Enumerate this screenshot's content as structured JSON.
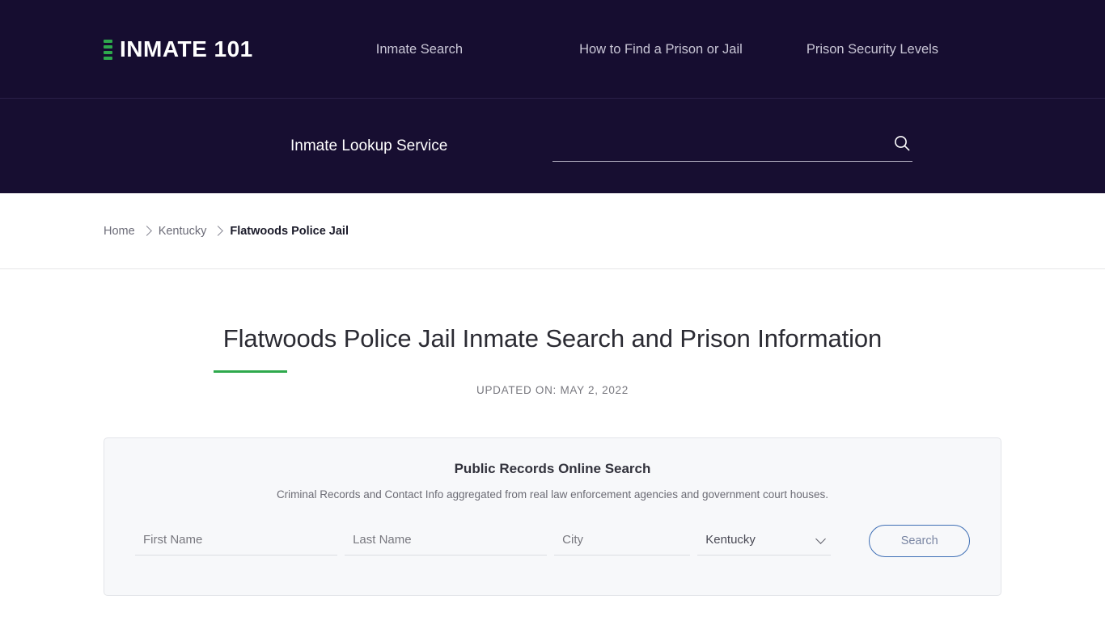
{
  "header": {
    "brand": "INMATE 101",
    "logo_icon": "stacked-bars-icon",
    "nav": [
      {
        "label": "Inmate Search"
      },
      {
        "label": "How to Find a Prison or Jail"
      },
      {
        "label": "Prison Security Levels"
      }
    ],
    "accent_color": "#2ea94c",
    "background_color": "#160D30"
  },
  "lookup": {
    "label": "Inmate Lookup Service",
    "input_value": "",
    "input_placeholder": "",
    "search_icon": "magnifier-icon"
  },
  "breadcrumb": {
    "items": [
      {
        "label": "Home"
      },
      {
        "label": "Kentucky"
      },
      {
        "label": "Flatwoods Police Jail"
      }
    ]
  },
  "main": {
    "title": "Flatwoods Police Jail Inmate Search and Prison Information",
    "updated": "UPDATED ON: MAY 2, 2022"
  },
  "records_card": {
    "title": "Public Records Online Search",
    "subtitle": "Criminal Records and Contact Info aggregated from real law enforcement agencies and government court houses.",
    "fields": {
      "first_name": {
        "value": "",
        "placeholder": "First Name"
      },
      "last_name": {
        "value": "",
        "placeholder": "Last Name"
      },
      "city": {
        "value": "",
        "placeholder": "City"
      },
      "state": {
        "selected": "Kentucky",
        "options": [
          "Kentucky"
        ]
      }
    },
    "submit_label": "Search"
  }
}
